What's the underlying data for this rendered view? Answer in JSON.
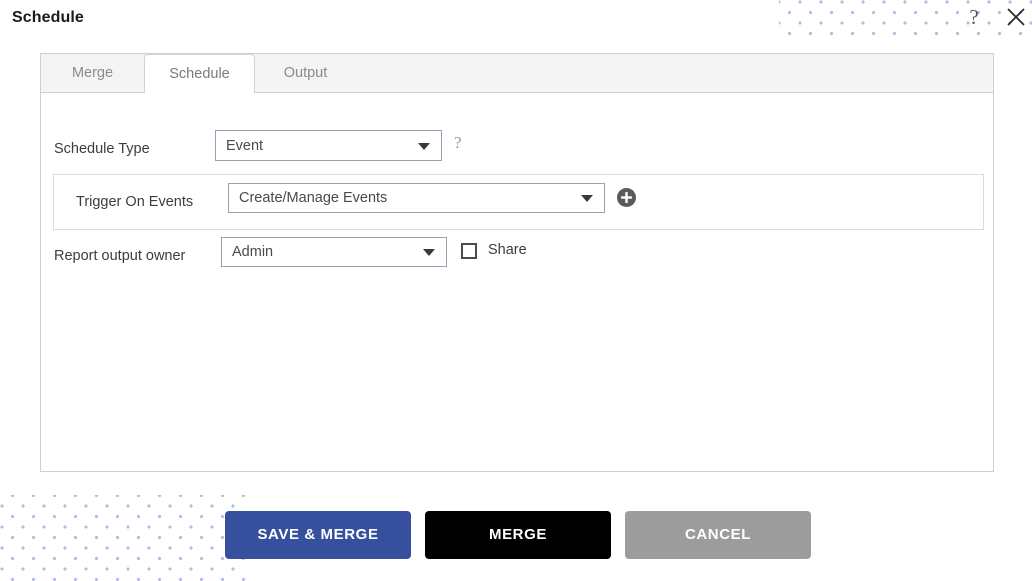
{
  "window": {
    "title": "Schedule",
    "help_icon": "question-mark-icon",
    "close_icon": "close-x-icon"
  },
  "tabs": [
    {
      "label": "Merge",
      "active": false
    },
    {
      "label": "Schedule",
      "active": true
    },
    {
      "label": "Output",
      "active": false
    }
  ],
  "form": {
    "schedule_type": {
      "label": "Schedule Type",
      "value": "Event",
      "help_icon": "question-mark-icon"
    },
    "trigger_on_events": {
      "label": "Trigger On Events",
      "value": "Create/Manage Events",
      "add_icon": "plus-circle-icon"
    },
    "report_output_owner": {
      "label": "Report output owner",
      "value": "Admin"
    },
    "share": {
      "label": "Share",
      "checked": false
    }
  },
  "footer": {
    "save_merge_label": "SAVE & MERGE",
    "merge_label": "MERGE",
    "cancel_label": "CANCEL"
  },
  "colors": {
    "primary": "#37509e",
    "merge": "#000000",
    "cancel": "#9c9c9c",
    "dot_pattern": "#9aa3dd",
    "panel_border": "#cfcfcf",
    "tab_strip": "#f4f4f4"
  }
}
